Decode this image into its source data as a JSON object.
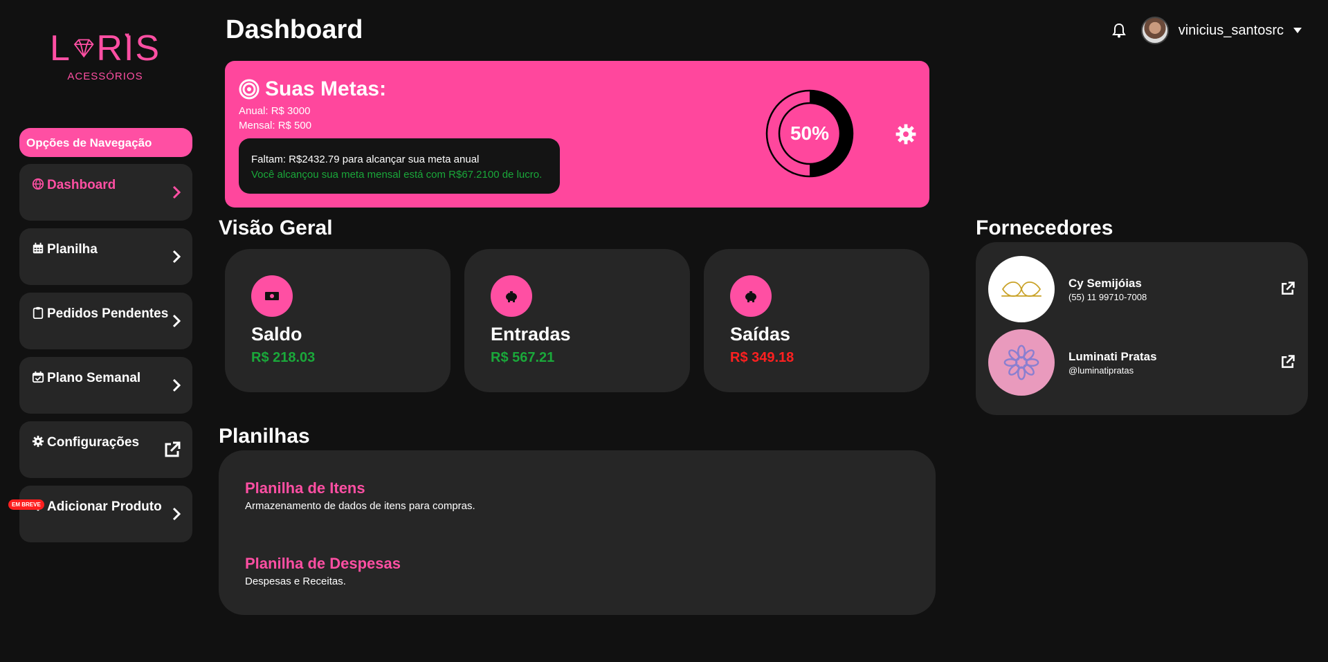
{
  "logo": {
    "brand": "L◆RIS",
    "subtitle": "ACESSÓRIOS"
  },
  "header": {
    "title": "Dashboard",
    "username": "vinicius_santosrc"
  },
  "sidebar": {
    "header": "Opções de Navegação",
    "items": [
      {
        "label": "Dashboard",
        "icon": "globe-icon",
        "action": "chevron-right-icon",
        "active": true
      },
      {
        "label": "Planilha",
        "icon": "calendar-icon",
        "action": "chevron-right-icon"
      },
      {
        "label": "Pedidos Pendentes",
        "icon": "clipboard-icon",
        "action": "chevron-right-icon"
      },
      {
        "label": "Plano Semanal",
        "icon": "calendar-check-icon",
        "action": "chevron-right-icon"
      },
      {
        "label": "Configurações",
        "icon": "gear-icon",
        "action": "external-link-icon"
      },
      {
        "label": "Adicionar Produto",
        "icon": "plus-icon",
        "action": "chevron-right-icon",
        "badge": "EM BREVE"
      }
    ]
  },
  "goals": {
    "title": "Suas Metas:",
    "annual": "Anual: R$ 3000",
    "monthly": "Mensal: R$ 500",
    "remaining": "Faltam: R$2432.79 para alcançar sua meta anual",
    "achieved": "Você alcançou sua meta mensal está com R$67.2100 de lucro.",
    "progress_label": "50%",
    "progress": 0.5
  },
  "overview": {
    "title": "Visão Geral",
    "cards": [
      {
        "label": "Saldo",
        "value": "R$ 218.03",
        "icon": "money-bill-icon",
        "status": "positive"
      },
      {
        "label": "Entradas",
        "value": "R$ 567.21",
        "icon": "piggy-bank-icon",
        "status": "positive"
      },
      {
        "label": "Saídas",
        "value": "R$ 349.18",
        "icon": "piggy-bank-icon",
        "status": "negative"
      }
    ]
  },
  "sheets": {
    "title": "Planilhas",
    "items": [
      {
        "title": "Planilha de Itens",
        "desc": "Armazenamento de dados de itens para compras."
      },
      {
        "title": "Planilha de Despesas",
        "desc": "Despesas e Receitas."
      }
    ]
  },
  "suppliers": {
    "title": "Fornecedores",
    "items": [
      {
        "name": "Cy Semijóias",
        "contact": "(55) 11 99710-7008"
      },
      {
        "name": "Luminati Pratas",
        "contact": "@luminatipratas"
      }
    ]
  },
  "colors": {
    "accent": "#ff4fa3",
    "background": "#111111",
    "card": "#262626",
    "positive": "#1aa83a",
    "negative": "#ff2020"
  }
}
